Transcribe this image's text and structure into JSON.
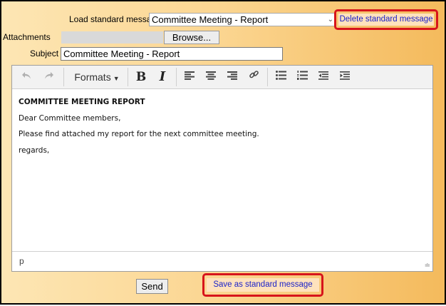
{
  "form": {
    "load_label": "Load standard message",
    "load_value": "Committee Meeting - Report",
    "delete_label": "Delete standard message",
    "attachments_label": "Attachments",
    "browse_label": "Browse...",
    "subject_label": "Subject",
    "subject_value": "Committee Meeting - Report"
  },
  "toolbar": {
    "undo_icon": "undo-icon",
    "redo_icon": "redo-icon",
    "formats_label": "Formats",
    "bold_label": "B",
    "italic_label": "I"
  },
  "editor": {
    "lines": [
      "COMMITTEE MEETING REPORT",
      "Dear Committee members,",
      "Please find attached my report for the next committee meeting.",
      "regards,"
    ],
    "status_path": "p"
  },
  "actions": {
    "send_label": "Send",
    "save_label": "Save as standard message"
  },
  "colors": {
    "highlight": "#d7141b",
    "link_text": "#1a22c9"
  }
}
